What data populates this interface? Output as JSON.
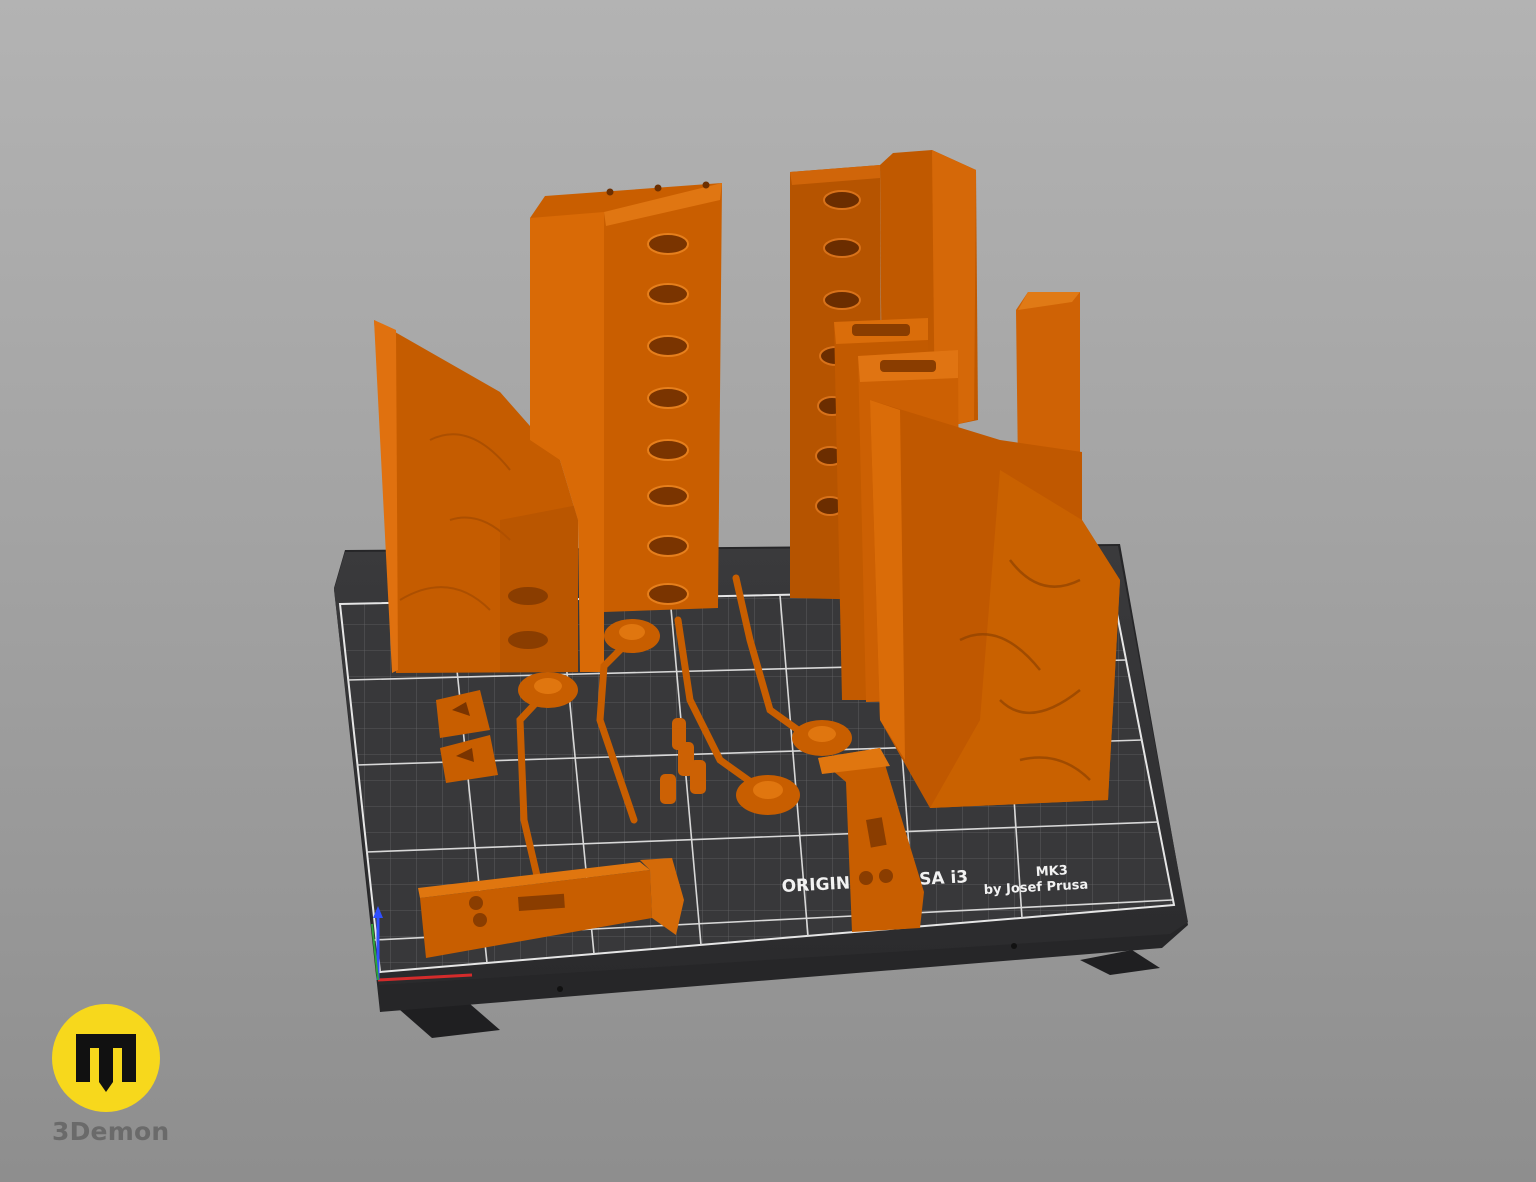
{
  "viewer": {
    "bed": {
      "label_line1": "ORIGINAL PRUSA i3",
      "label_model": "MK3",
      "label_line2": "by Josef Prusa"
    }
  },
  "brand": {
    "watermark_text": "3Demon",
    "watermark_logo_letter": "m",
    "accent_color": "#f7d81c",
    "model_color": "#c85f00",
    "bed_color": "#2f2f31"
  }
}
